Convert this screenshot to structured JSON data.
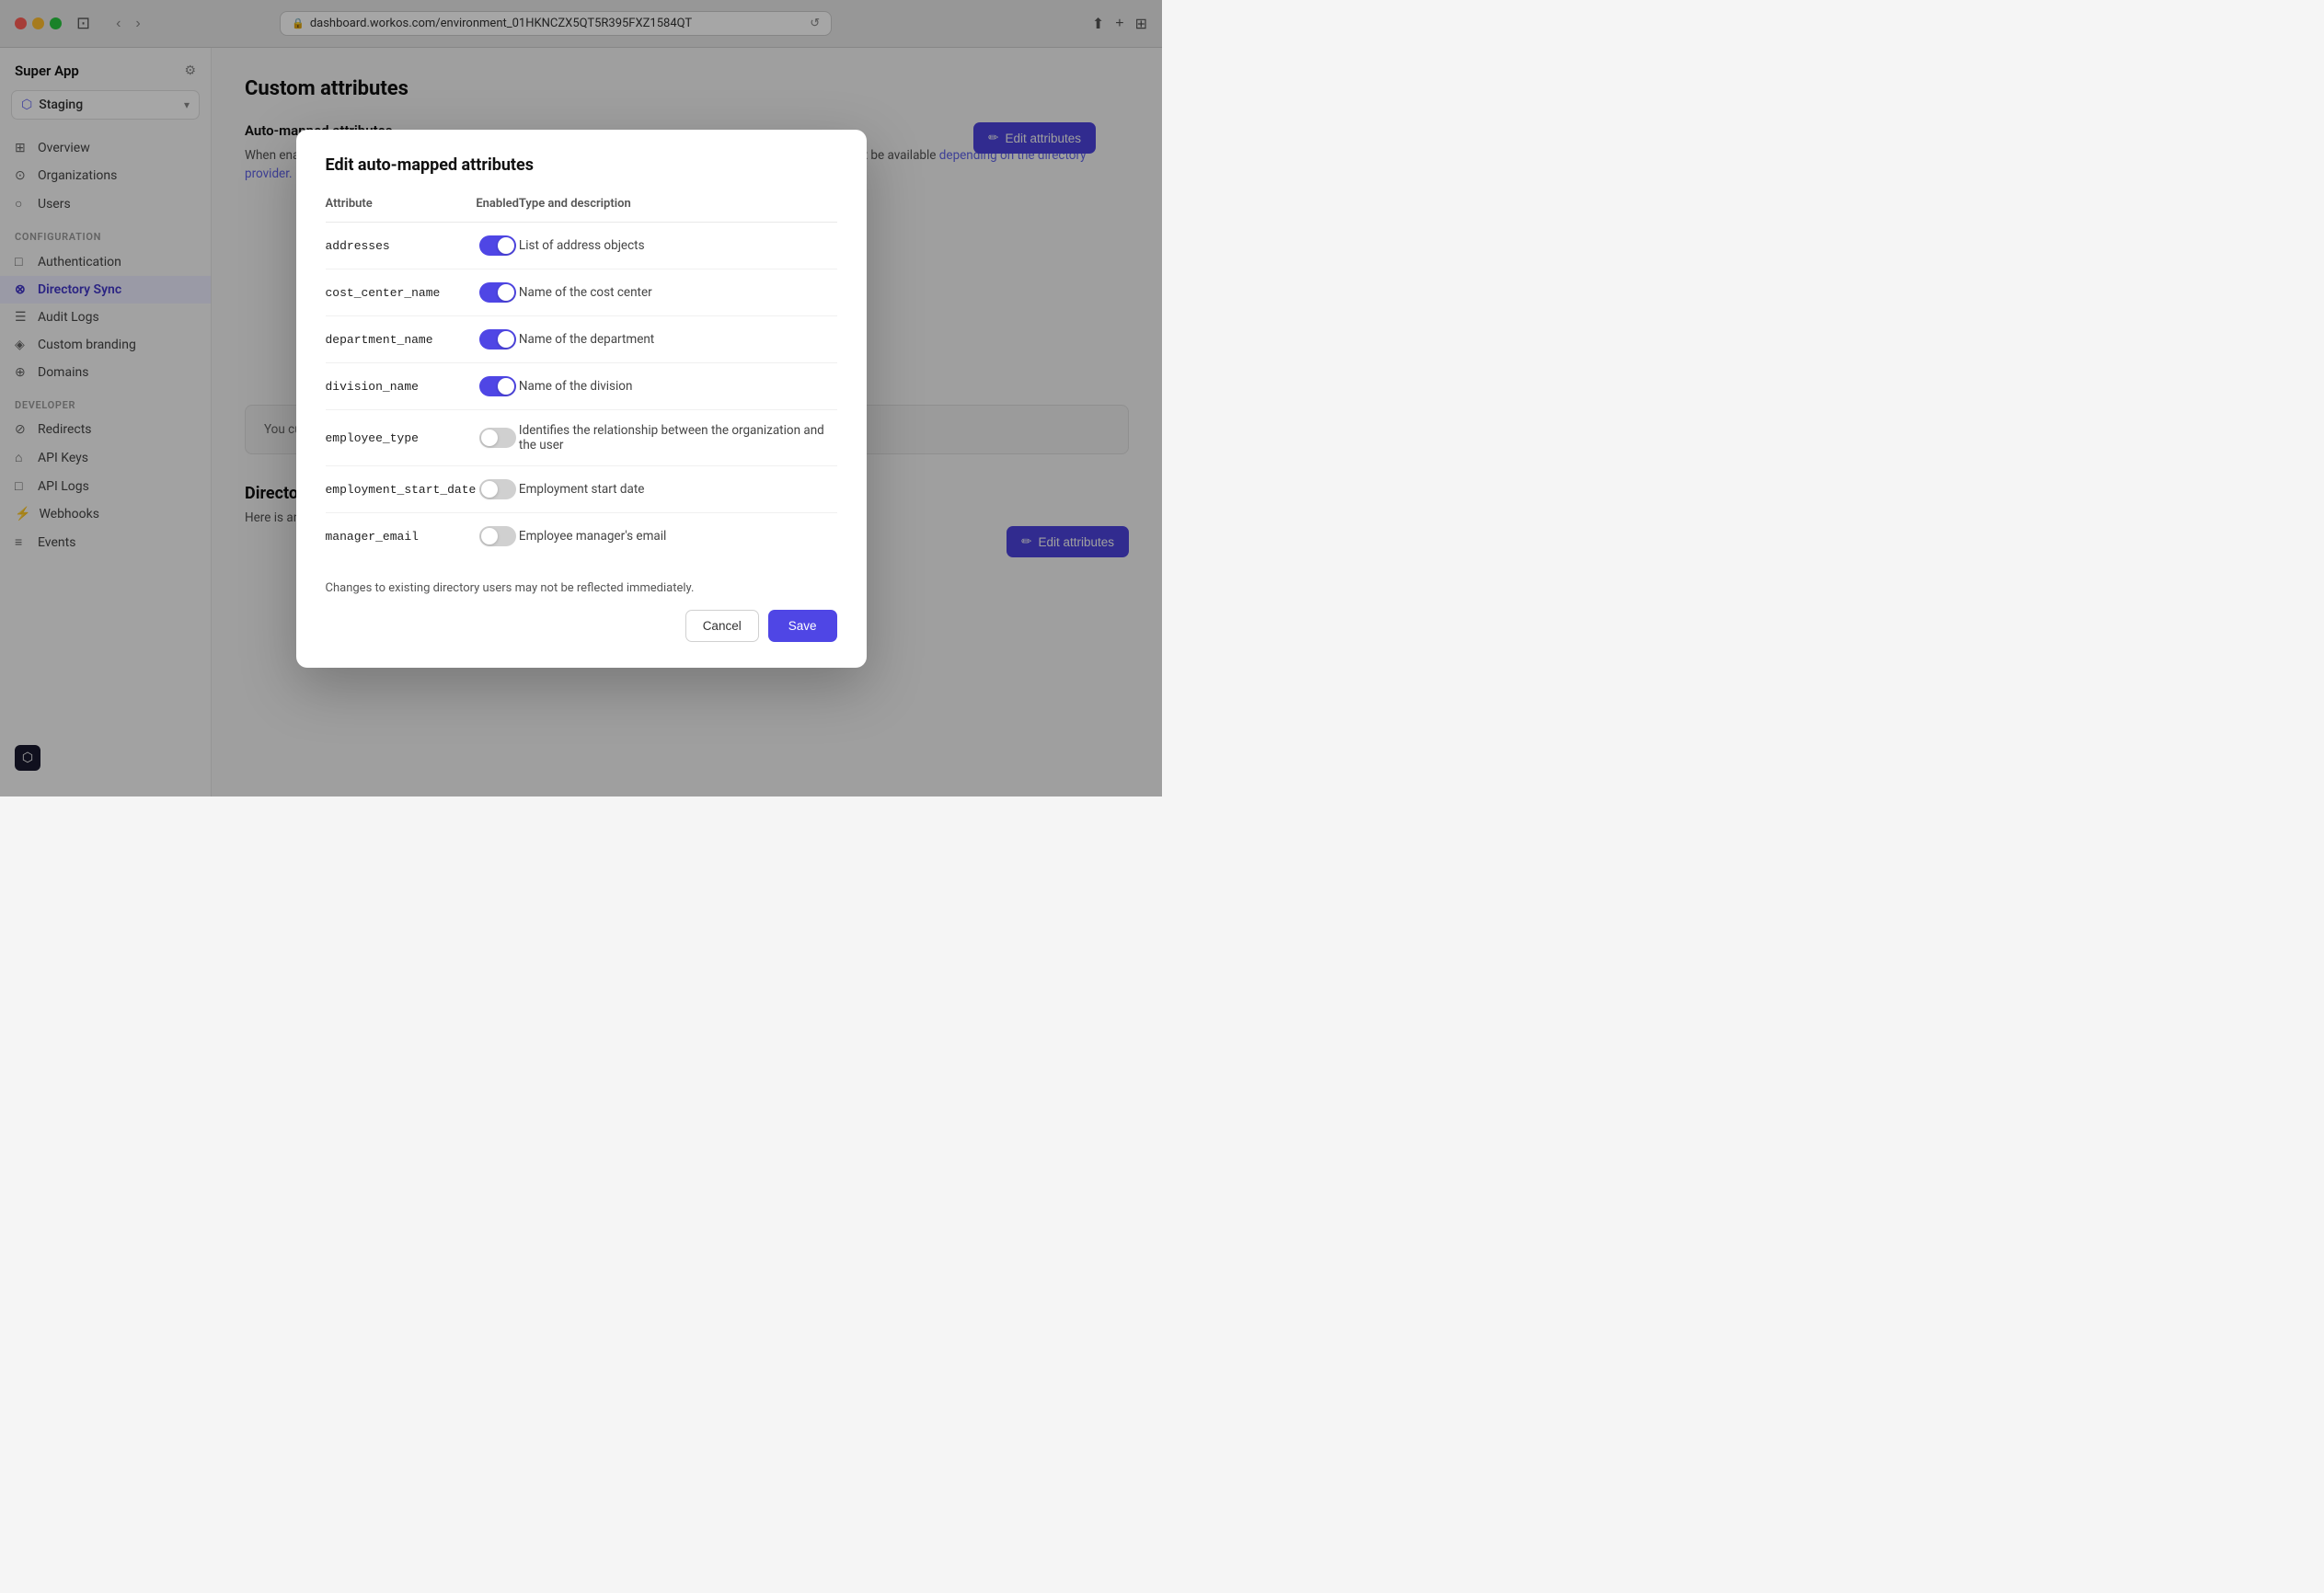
{
  "browser": {
    "url": "dashboard.workos.com/environment_01HKNCZX5QT5R395FXZ1584QT"
  },
  "sidebar": {
    "app_name": "Super App",
    "env_name": "Staging",
    "nav_items": [
      {
        "id": "overview",
        "label": "Overview",
        "icon": "⊞"
      },
      {
        "id": "organizations",
        "label": "Organizations",
        "icon": "⊙"
      },
      {
        "id": "users",
        "label": "Users",
        "icon": "○"
      }
    ],
    "config_section": "CONFIGURATION",
    "config_items": [
      {
        "id": "authentication",
        "label": "Authentication",
        "icon": "□"
      },
      {
        "id": "directory-sync",
        "label": "Directory Sync",
        "icon": "⊗",
        "active": true
      },
      {
        "id": "audit-logs",
        "label": "Audit Logs",
        "icon": "☰"
      },
      {
        "id": "custom-branding",
        "label": "Custom branding",
        "icon": "◈"
      },
      {
        "id": "domains",
        "label": "Domains",
        "icon": "⊕"
      }
    ],
    "developer_section": "DEVELOPER",
    "developer_items": [
      {
        "id": "redirects",
        "label": "Redirects",
        "icon": "⊘"
      },
      {
        "id": "api-keys",
        "label": "API Keys",
        "icon": "⌂"
      },
      {
        "id": "api-logs",
        "label": "API Logs",
        "icon": "□"
      },
      {
        "id": "webhooks",
        "label": "Webhooks",
        "icon": "⚡"
      },
      {
        "id": "events",
        "label": "Events",
        "icon": "≡"
      }
    ]
  },
  "main": {
    "page_title": "Custom attributes",
    "auto_mapped_section": {
      "title": "Auto-mapped attributes",
      "description_before": "When enabled, the values will be mapped without additional set up. Auto-mapped attribute values may or may not be available ",
      "description_link": "depending on the directory provider.",
      "description_after": ""
    },
    "edit_attributes_label": "Edit attributes",
    "no_custom_attrs": "You currently have no custom attributes defined.",
    "directory_preview": {
      "title": "Directory User Preview",
      "description": "Here is an example payload with your current standard and custom attributes."
    }
  },
  "modal": {
    "title": "Edit auto-mapped attributes",
    "columns": {
      "attribute": "Attribute",
      "enabled": "Enabled",
      "type_desc": "Type and description"
    },
    "rows": [
      {
        "name": "addresses",
        "enabled": true,
        "description": "List of address objects"
      },
      {
        "name": "cost_center_name",
        "enabled": true,
        "description": "Name of the cost center"
      },
      {
        "name": "department_name",
        "enabled": true,
        "description": "Name of the department"
      },
      {
        "name": "division_name",
        "enabled": true,
        "description": "Name of the division"
      },
      {
        "name": "employee_type",
        "enabled": false,
        "description": "Identifies the relationship between the organization and the user"
      },
      {
        "name": "employment_start_date",
        "enabled": false,
        "description": "Employment start date"
      },
      {
        "name": "manager_email",
        "enabled": false,
        "description": "Employee manager's email"
      }
    ],
    "footer_note": "Changes to existing directory users may not be reflected immediately.",
    "cancel_label": "Cancel",
    "save_label": "Save"
  }
}
